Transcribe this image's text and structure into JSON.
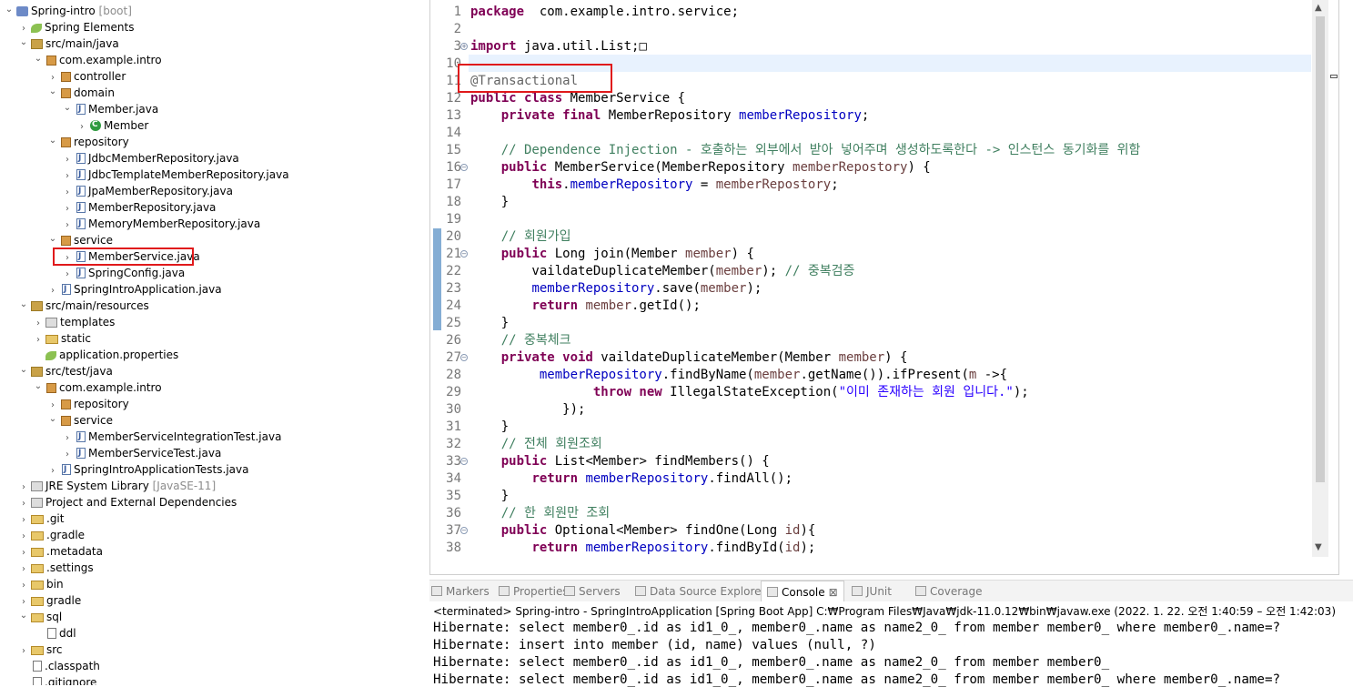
{
  "tree": [
    {
      "id": "t0",
      "label": "Spring-intro",
      "suffix": " [boot]",
      "icon": "project-icon",
      "chev": "down",
      "indent": 0
    },
    {
      "id": "t1",
      "label": "Spring Elements",
      "icon": "spring-leaf-icon",
      "chev": "right",
      "indent": 1
    },
    {
      "id": "t2",
      "label": "src/main/java",
      "icon": "source-folder-icon",
      "chev": "down",
      "indent": 1
    },
    {
      "id": "t3",
      "label": "com.example.intro",
      "icon": "package-icon",
      "chev": "down",
      "indent": 2
    },
    {
      "id": "t4",
      "label": "controller",
      "icon": "package-icon",
      "chev": "right",
      "indent": 3
    },
    {
      "id": "t5",
      "label": "domain",
      "icon": "package-icon",
      "chev": "down",
      "indent": 3
    },
    {
      "id": "t6",
      "label": "Member.java",
      "icon": "java-file-icon",
      "chev": "down",
      "indent": 4
    },
    {
      "id": "t7",
      "label": "Member",
      "icon": "class-icon",
      "chev": "right",
      "indent": 5
    },
    {
      "id": "t8",
      "label": "repository",
      "icon": "package-icon",
      "chev": "down",
      "indent": 3
    },
    {
      "id": "t9",
      "label": "JdbcMemberRepository.java",
      "icon": "java-file-icon",
      "chev": "right",
      "indent": 4
    },
    {
      "id": "t10",
      "label": "JdbcTemplateMemberRepository.java",
      "icon": "java-file-icon",
      "chev": "right",
      "indent": 4
    },
    {
      "id": "t11",
      "label": "JpaMemberRepository.java",
      "icon": "java-file-icon",
      "chev": "right",
      "indent": 4
    },
    {
      "id": "t12",
      "label": "MemberRepository.java",
      "icon": "java-file-icon",
      "chev": "right",
      "indent": 4
    },
    {
      "id": "t13",
      "label": "MemoryMemberRepository.java",
      "icon": "java-file-icon",
      "chev": "right",
      "indent": 4
    },
    {
      "id": "t14",
      "label": "service",
      "icon": "package-icon",
      "chev": "down",
      "indent": 3
    },
    {
      "id": "t15",
      "label": "MemberService.java",
      "icon": "java-file-icon",
      "chev": "right",
      "indent": 4
    },
    {
      "id": "t16",
      "label": "SpringConfig.java",
      "icon": "java-file-icon",
      "chev": "right",
      "indent": 4
    },
    {
      "id": "t17",
      "label": "SpringIntroApplication.java",
      "icon": "java-file-icon",
      "chev": "right",
      "indent": 3
    },
    {
      "id": "t18",
      "label": "src/main/resources",
      "icon": "source-folder-icon",
      "chev": "down",
      "indent": 1
    },
    {
      "id": "t19",
      "label": "templates",
      "icon": "library-icon",
      "chev": "right",
      "indent": 2
    },
    {
      "id": "t20",
      "label": "static",
      "icon": "folder-icon",
      "chev": "right",
      "indent": 2
    },
    {
      "id": "t21",
      "label": "application.properties",
      "icon": "spring-leaf-icon",
      "chev": "",
      "indent": 2
    },
    {
      "id": "t22",
      "label": "src/test/java",
      "icon": "source-folder-icon",
      "chev": "down",
      "indent": 1
    },
    {
      "id": "t23",
      "label": "com.example.intro",
      "icon": "package-icon",
      "chev": "down",
      "indent": 2
    },
    {
      "id": "t24",
      "label": "repository",
      "icon": "package-icon",
      "chev": "right",
      "indent": 3
    },
    {
      "id": "t25",
      "label": "service",
      "icon": "package-icon",
      "chev": "down",
      "indent": 3
    },
    {
      "id": "t26",
      "label": "MemberServiceIntegrationTest.java",
      "icon": "java-file-icon",
      "chev": "right",
      "indent": 4
    },
    {
      "id": "t27",
      "label": "MemberServiceTest.java",
      "icon": "java-file-icon",
      "chev": "right",
      "indent": 4
    },
    {
      "id": "t28",
      "label": "SpringIntroApplicationTests.java",
      "icon": "java-file-icon",
      "chev": "right",
      "indent": 3
    },
    {
      "id": "t29",
      "label": "JRE System Library",
      "suffix": " [JavaSE-11]",
      "icon": "library-icon",
      "chev": "right",
      "indent": 1
    },
    {
      "id": "t30",
      "label": "Project and External Dependencies",
      "icon": "library-icon",
      "chev": "right",
      "indent": 1
    },
    {
      "id": "t31",
      "label": ".git",
      "icon": "folder-icon",
      "chev": "right",
      "indent": 1
    },
    {
      "id": "t32",
      "label": ".gradle",
      "icon": "folder-icon",
      "chev": "right",
      "indent": 1
    },
    {
      "id": "t33",
      "label": ".metadata",
      "icon": "folder-icon",
      "chev": "right",
      "indent": 1
    },
    {
      "id": "t34",
      "label": ".settings",
      "icon": "folder-icon",
      "chev": "right",
      "indent": 1
    },
    {
      "id": "t35",
      "label": "bin",
      "icon": "folder-icon",
      "chev": "right",
      "indent": 1
    },
    {
      "id": "t36",
      "label": "gradle",
      "icon": "folder-icon",
      "chev": "right",
      "indent": 1
    },
    {
      "id": "t37",
      "label": "sql",
      "icon": "folder-icon",
      "chev": "down",
      "indent": 1
    },
    {
      "id": "t38",
      "label": "ddl",
      "icon": "file-icon",
      "chev": "",
      "indent": 2
    },
    {
      "id": "t39",
      "label": "src",
      "icon": "folder-icon",
      "chev": "right",
      "indent": 1
    },
    {
      "id": "t40",
      "label": ".classpath",
      "icon": "file-icon",
      "chev": "",
      "indent": 1
    },
    {
      "id": "t41",
      "label": ".gitignore",
      "icon": "file-icon",
      "chev": "",
      "indent": 1
    }
  ],
  "editor": {
    "lines": [
      {
        "n": "1",
        "fold": "",
        "parts": [
          [
            "kw",
            "package"
          ],
          [
            "",
            "  com.example.intro.service;"
          ]
        ]
      },
      {
        "n": "2",
        "fold": "",
        "parts": []
      },
      {
        "n": "3",
        "fold": "+",
        "parts": [
          [
            "kw",
            "import"
          ],
          [
            "",
            " java.util.List;"
          ],
          [
            "",
            "□"
          ]
        ]
      },
      {
        "n": "10",
        "fold": "",
        "parts": []
      },
      {
        "n": "11",
        "fold": "",
        "parts": [
          [
            "ann",
            "@Transactional"
          ]
        ]
      },
      {
        "n": "12",
        "fold": "",
        "parts": [
          [
            "kw",
            "public class"
          ],
          [
            "",
            " MemberService {"
          ]
        ]
      },
      {
        "n": "13",
        "fold": "",
        "parts": [
          [
            "",
            "    "
          ],
          [
            "kw",
            "private final"
          ],
          [
            "",
            " MemberRepository "
          ],
          [
            "fld",
            "memberRepository"
          ],
          [
            "",
            ";"
          ]
        ]
      },
      {
        "n": "14",
        "fold": "",
        "parts": []
      },
      {
        "n": "15",
        "fold": "",
        "parts": [
          [
            "",
            "    "
          ],
          [
            "cm",
            "// Dependence Injection - 호출하는 외부에서 받아 넣어주며 생성하도록한다 -> 인스턴스 동기화를 위함"
          ]
        ]
      },
      {
        "n": "16",
        "fold": "-",
        "parts": [
          [
            "",
            "    "
          ],
          [
            "kw",
            "public"
          ],
          [
            "",
            " MemberService(MemberRepository "
          ],
          [
            "prm",
            "memberRepostory"
          ],
          [
            "",
            ") {"
          ]
        ]
      },
      {
        "n": "17",
        "fold": "",
        "parts": [
          [
            "",
            "        "
          ],
          [
            "kw",
            "this"
          ],
          [
            "",
            "."
          ],
          [
            "fld",
            "memberRepository"
          ],
          [
            "",
            " = "
          ],
          [
            "prm",
            "memberRepostory"
          ],
          [
            "",
            ";"
          ]
        ]
      },
      {
        "n": "18",
        "fold": "",
        "parts": [
          [
            "",
            "    }"
          ]
        ]
      },
      {
        "n": "19",
        "fold": "",
        "parts": []
      },
      {
        "n": "20",
        "fold": "",
        "parts": [
          [
            "",
            "    "
          ],
          [
            "cm",
            "// 회원가입"
          ]
        ]
      },
      {
        "n": "21",
        "fold": "-",
        "parts": [
          [
            "",
            "    "
          ],
          [
            "kw",
            "public"
          ],
          [
            "",
            " Long join(Member "
          ],
          [
            "prm",
            "member"
          ],
          [
            "",
            ") {"
          ]
        ]
      },
      {
        "n": "22",
        "fold": "",
        "parts": [
          [
            "",
            "        vaildateDuplicateMember("
          ],
          [
            "prm",
            "member"
          ],
          [
            "",
            "); "
          ],
          [
            "cm",
            "// 중복검증"
          ]
        ]
      },
      {
        "n": "23",
        "fold": "",
        "parts": [
          [
            "",
            "        "
          ],
          [
            "fld",
            "memberRepository"
          ],
          [
            "",
            ".save("
          ],
          [
            "prm",
            "member"
          ],
          [
            "",
            ");"
          ]
        ]
      },
      {
        "n": "24",
        "fold": "",
        "parts": [
          [
            "",
            "        "
          ],
          [
            "kw",
            "return"
          ],
          [
            "",
            " "
          ],
          [
            "prm",
            "member"
          ],
          [
            "",
            ".getId();"
          ]
        ]
      },
      {
        "n": "25",
        "fold": "",
        "parts": [
          [
            "",
            "    }"
          ]
        ]
      },
      {
        "n": "26",
        "fold": "",
        "parts": [
          [
            "",
            "    "
          ],
          [
            "cm",
            "// 중복체크"
          ]
        ]
      },
      {
        "n": "27",
        "fold": "-",
        "parts": [
          [
            "",
            "    "
          ],
          [
            "kw",
            "private void"
          ],
          [
            "",
            " vaildateDuplicateMember(Member "
          ],
          [
            "prm",
            "member"
          ],
          [
            "",
            ") {"
          ]
        ]
      },
      {
        "n": "28",
        "fold": "",
        "parts": [
          [
            "",
            "         "
          ],
          [
            "fld",
            "memberRepository"
          ],
          [
            "",
            ".findByName("
          ],
          [
            "prm",
            "member"
          ],
          [
            "",
            ".getName()).ifPresent("
          ],
          [
            "prm",
            "m"
          ],
          [
            "",
            " ->{"
          ]
        ]
      },
      {
        "n": "29",
        "fold": "",
        "parts": [
          [
            "",
            "                "
          ],
          [
            "kw",
            "throw new"
          ],
          [
            "",
            " IllegalStateException("
          ],
          [
            "str",
            "\"이미 존재하는 회원 입니다.\""
          ],
          [
            "",
            ");"
          ]
        ]
      },
      {
        "n": "30",
        "fold": "",
        "parts": [
          [
            "",
            "            });"
          ]
        ]
      },
      {
        "n": "31",
        "fold": "",
        "parts": [
          [
            "",
            "    }"
          ]
        ]
      },
      {
        "n": "32",
        "fold": "",
        "parts": [
          [
            "",
            "    "
          ],
          [
            "cm",
            "// 전체 회원조회"
          ]
        ]
      },
      {
        "n": "33",
        "fold": "-",
        "parts": [
          [
            "",
            "    "
          ],
          [
            "kw",
            "public"
          ],
          [
            "",
            " List<Member> findMembers() {"
          ]
        ]
      },
      {
        "n": "34",
        "fold": "",
        "parts": [
          [
            "",
            "        "
          ],
          [
            "kw",
            "return"
          ],
          [
            "",
            " "
          ],
          [
            "fld",
            "memberRepository"
          ],
          [
            "",
            ".findAll();"
          ]
        ]
      },
      {
        "n": "35",
        "fold": "",
        "parts": [
          [
            "",
            "    }"
          ]
        ]
      },
      {
        "n": "36",
        "fold": "",
        "parts": [
          [
            "",
            "    "
          ],
          [
            "cm",
            "// 한 회원만 조회"
          ]
        ]
      },
      {
        "n": "37",
        "fold": "-",
        "parts": [
          [
            "",
            "    "
          ],
          [
            "kw",
            "public"
          ],
          [
            "",
            " Optional<Member> findOne(Long "
          ],
          [
            "prm",
            "id"
          ],
          [
            "",
            "){"
          ]
        ]
      },
      {
        "n": "38",
        "fold": "",
        "parts": [
          [
            "",
            "        "
          ],
          [
            "kw",
            "return"
          ],
          [
            "",
            " "
          ],
          [
            "fld",
            "memberRepository"
          ],
          [
            "",
            ".findById("
          ],
          [
            "prm",
            "id"
          ],
          [
            "",
            ");"
          ]
        ]
      }
    ]
  },
  "tabs": [
    {
      "label": "Markers",
      "icon": "markers-icon",
      "active": false
    },
    {
      "label": "Properties",
      "icon": "properties-icon",
      "active": false
    },
    {
      "label": "Servers",
      "icon": "servers-icon",
      "active": false
    },
    {
      "label": "Data Source Explorer",
      "icon": "data-source-icon",
      "active": false
    },
    {
      "label": "Console",
      "icon": "console-icon",
      "active": true,
      "close": "⊠"
    },
    {
      "label": "JUnit",
      "icon": "junit-icon",
      "active": false
    },
    {
      "label": "Coverage",
      "icon": "coverage-icon",
      "active": false
    }
  ],
  "console": {
    "terminated": "<terminated> Spring-intro - SpringIntroApplication [Spring Boot App] C:₩Program Files₩Java₩jdk-11.0.12₩bin₩javaw.exe  (2022. 1. 22. 오전 1:40:59 – 오전 1:42:03)",
    "lines": [
      "Hibernate: select member0_.id as id1_0_, member0_.name as name2_0_ from member member0_ where member0_.name=?",
      "Hibernate: insert into member (id, name) values (null, ?)",
      "Hibernate: select member0_.id as id1_0_, member0_.name as name2_0_ from member member0_",
      "Hibernate: select member0_.id as id1_0_, member0_.name as name2_0_ from member member0_ where member0_.name=?"
    ]
  }
}
